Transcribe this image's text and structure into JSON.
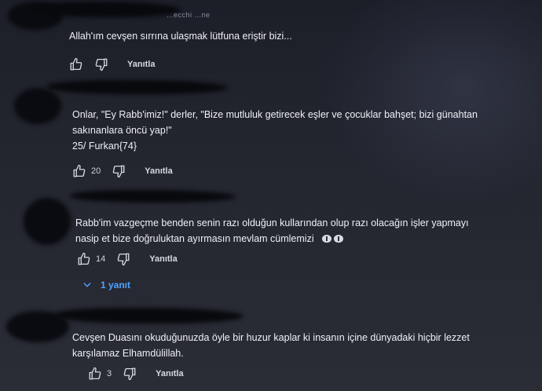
{
  "comments": [
    {
      "author_partial": "...ecchi ...ne",
      "text": "Allah'ım cevşen sırrına ulaşmak lütfuna eriştir bizi...",
      "likes": "",
      "reply_label": "Yanıtla"
    },
    {
      "text_line1": "Onlar, \"Ey Rabb'imiz!\" derler, \"Bize mutluluk getirecek eşler ve çocuklar bahşet; bizi günahtan",
      "text_line2": "sakınanlara öncü yap!\"",
      "text_line3": "25/ Furkan{74}",
      "likes": "20",
      "reply_label": "Yanıtla"
    },
    {
      "text_line1": "Rabb'im vazgeçme benden senin razı olduğun kullarından olup razı olacağın işler yapmayı",
      "text_line2": "nasip et bize doğruluktan ayırmasın mevlam cümlemizi",
      "emoji": "🤲🤲",
      "likes": "14",
      "reply_label": "Yanıtla",
      "replies_label": "1 yanıt"
    },
    {
      "text_line1": "Cevşen Duasını okuduğunuzda öyle bir huzur kaplar ki insanın içine dünyadaki hiçbir lezzet",
      "text_line2": "karşılamaz Elhamdülillah.",
      "likes": "3",
      "reply_label": "Yanıtla"
    }
  ],
  "icons": {
    "like": "thumbs-up-icon",
    "dislike": "thumbs-down-icon",
    "expand": "chevron-down-icon"
  },
  "colors": {
    "background": "#20222c",
    "text": "#f0f1f6",
    "link": "#4ea3ff"
  }
}
